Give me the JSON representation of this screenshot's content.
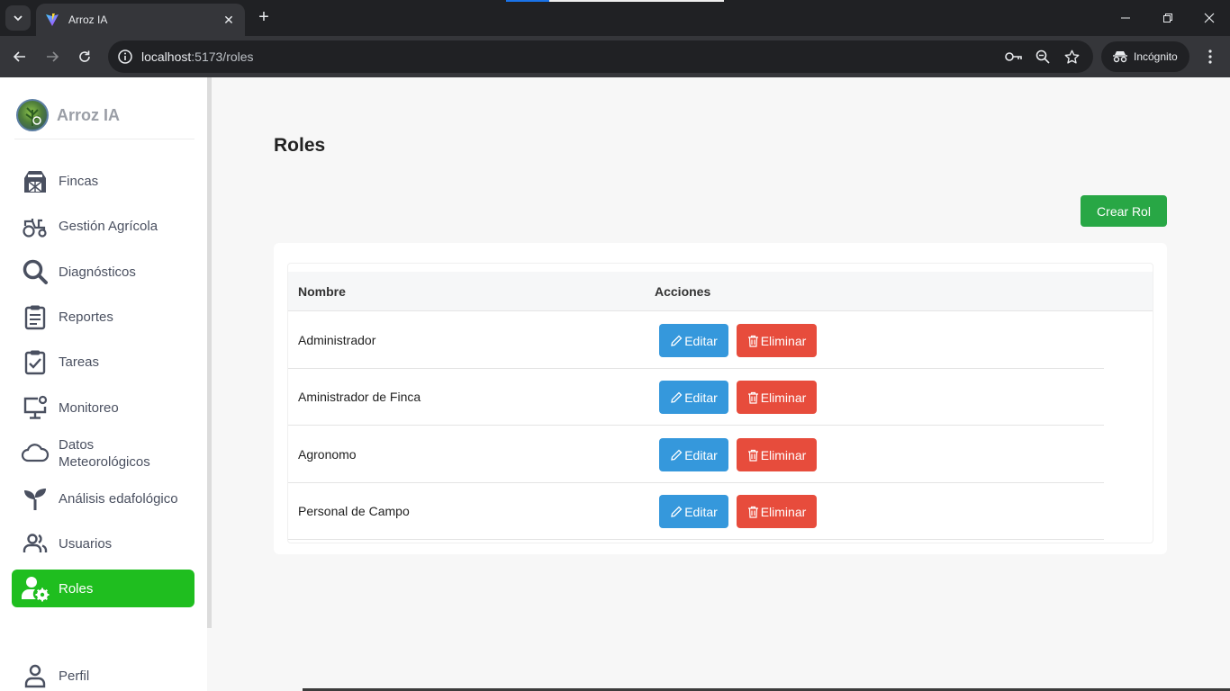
{
  "browser": {
    "tab_title": "Arroz IA",
    "url_host": "localhost",
    "url_rest": ":5173/roles",
    "incognito_label": "Incógnito"
  },
  "sidebar": {
    "brand": "Arroz IA",
    "items": [
      {
        "label": "Fincas",
        "icon": "barn-icon"
      },
      {
        "label": "Gestión Agrícola",
        "icon": "tractor-icon"
      },
      {
        "label": "Diagnósticos",
        "icon": "search-icon"
      },
      {
        "label": "Reportes",
        "icon": "clipboard-list-icon"
      },
      {
        "label": "Tareas",
        "icon": "clipboard-check-icon"
      },
      {
        "label": "Monitoreo",
        "icon": "monitor-icon"
      },
      {
        "label": "Datos Meteorológicos",
        "icon": "cloud-icon"
      },
      {
        "label": "Análisis edafológico",
        "icon": "seedling-icon"
      },
      {
        "label": "Usuarios",
        "icon": "users-icon"
      },
      {
        "label": "Roles",
        "icon": "user-gear-icon",
        "active": true
      },
      {
        "label": "Perfil",
        "icon": "user-icon"
      }
    ]
  },
  "main": {
    "title": "Roles",
    "create_button": "Crear Rol",
    "table": {
      "headers": [
        "Nombre",
        "Acciones"
      ],
      "rows": [
        {
          "name": "Administrador"
        },
        {
          "name": "Aministrador de Finca"
        },
        {
          "name": "Agronomo"
        },
        {
          "name": "Personal de Campo"
        }
      ],
      "edit_label": "Editar",
      "delete_label": "Eliminar"
    }
  },
  "colors": {
    "active_nav": "#1fbe1f",
    "create_button": "#28a745",
    "edit_button": "#3598dc",
    "delete_button": "#e74c3c"
  }
}
